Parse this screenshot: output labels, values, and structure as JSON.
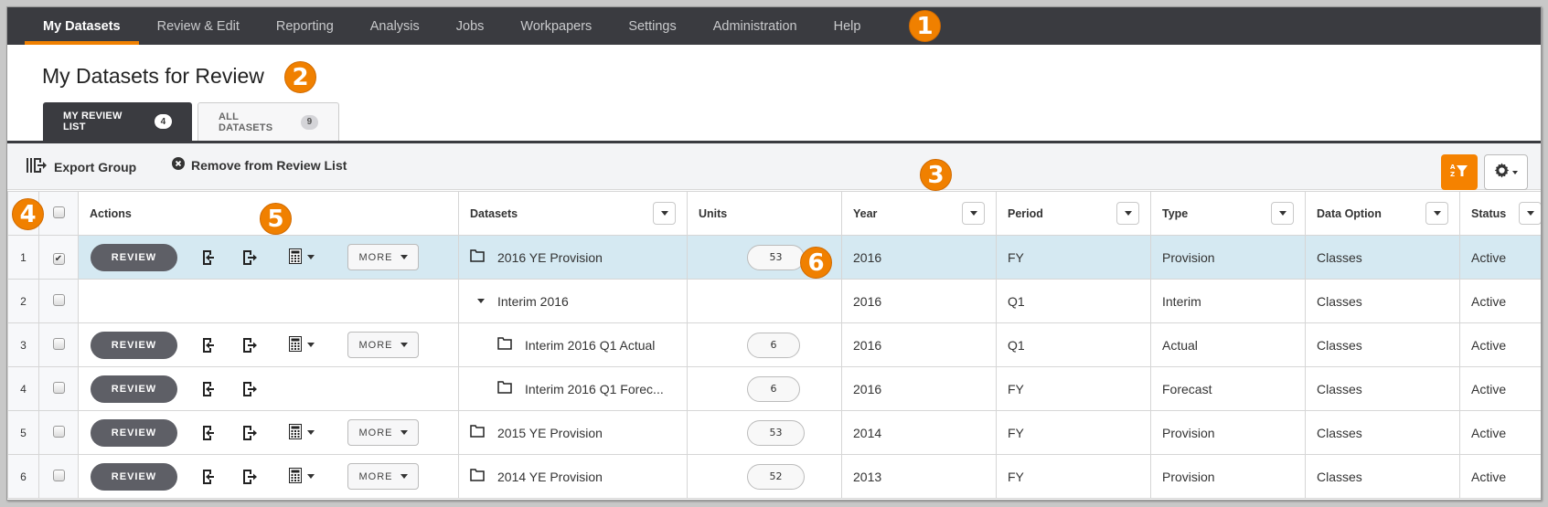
{
  "nav": {
    "items": [
      "My Datasets",
      "Review & Edit",
      "Reporting",
      "Analysis",
      "Jobs",
      "Workpapers",
      "Settings",
      "Administration",
      "Help"
    ],
    "active_index": 0
  },
  "callouts": [
    "1",
    "2",
    "3",
    "4",
    "5",
    "6"
  ],
  "page": {
    "title": "My Datasets for Review"
  },
  "tabs": [
    {
      "label": "MY REVIEW LIST",
      "count": "4",
      "active": true
    },
    {
      "label": "ALL DATASETS",
      "count": "9",
      "active": false
    }
  ],
  "toolbar": {
    "export_group": "Export Group",
    "remove_from_list": "Remove from Review List",
    "sort_filter_icon": "sort-az-filter-icon",
    "settings_icon": "gear-icon"
  },
  "table": {
    "headers": {
      "actions": "Actions",
      "datasets": "Datasets",
      "units": "Units",
      "year": "Year",
      "period": "Period",
      "type": "Type",
      "data_option": "Data Option",
      "status": "Status"
    },
    "review_label": "REVIEW",
    "more_label": "MORE",
    "rows": [
      {
        "num": "1",
        "checked": true,
        "dataset": "2016 YE Provision",
        "units": "53",
        "year": "2016",
        "period": "FY",
        "type": "Provision",
        "data_option": "Classes",
        "status": "Active"
      },
      {
        "num": "2",
        "checked": false,
        "dataset": "Interim 2016",
        "units": "",
        "year": "2016",
        "period": "Q1",
        "type": "Interim",
        "data_option": "Classes",
        "status": "Active"
      },
      {
        "num": "3",
        "checked": false,
        "dataset": "Interim 2016 Q1 Actual",
        "units": "6",
        "year": "2016",
        "period": "Q1",
        "type": "Actual",
        "data_option": "Classes",
        "status": "Active"
      },
      {
        "num": "4",
        "checked": false,
        "dataset": "Interim 2016 Q1 Forec...",
        "units": "6",
        "year": "2016",
        "period": "FY",
        "type": "Forecast",
        "data_option": "Classes",
        "status": "Active"
      },
      {
        "num": "5",
        "checked": false,
        "dataset": "2015 YE Provision",
        "units": "53",
        "year": "2014",
        "period": "FY",
        "type": "Provision",
        "data_option": "Classes",
        "status": "Active"
      },
      {
        "num": "6",
        "checked": false,
        "dataset": "2014 YE Provision",
        "units": "52",
        "year": "2013",
        "period": "FY",
        "type": "Provision",
        "data_option": "Classes",
        "status": "Active"
      }
    ]
  }
}
